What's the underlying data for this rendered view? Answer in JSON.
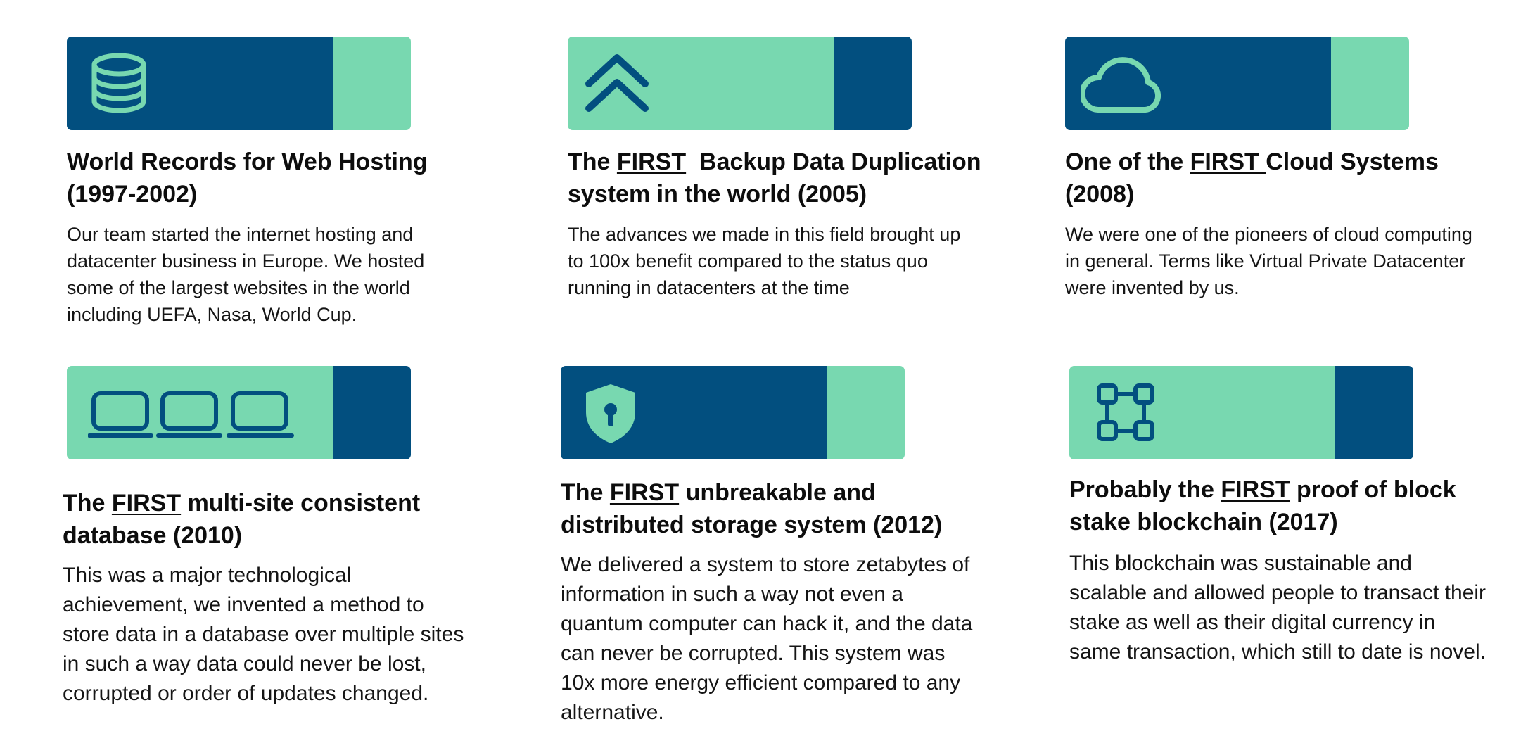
{
  "colors": {
    "dark": "#024f7f",
    "light": "#78d8b0"
  },
  "cards": [
    {
      "icon": "database-icon",
      "title_pre": "World Records for Web Hosting (1997-2002)",
      "title_highlight": "",
      "title_post": "",
      "description": "Our team started the internet hosting and datacenter business in Europe. We hosted some of the largest websites in the world including UEFA, Nasa, World Cup."
    },
    {
      "icon": "double-chevron-up-icon",
      "title_pre": "The ",
      "title_highlight": "FIRST",
      "title_post": "  Backup Data Duplication system in the world (2005)",
      "description": "The advances we made in this field brought up to 100x benefit compared to the status quo running in datacenters at the time"
    },
    {
      "icon": "cloud-icon",
      "title_pre": "One of the ",
      "title_highlight": "FIRST ",
      "title_post": "Cloud Systems (2008)",
      "description": "We were one of the pioneers of cloud computing in general. Terms like Virtual Private Datacenter were invented by us."
    },
    {
      "icon": "laptops-icon",
      "title_pre": "The ",
      "title_highlight": "FIRST",
      "title_post": " multi-site consistent database (2010)",
      "description": "This was a major technological achievement, we invented a method to store data in a database over multiple sites in such a way data could never be lost, corrupted or order of updates changed."
    },
    {
      "icon": "shield-lock-icon",
      "title_pre": "The ",
      "title_highlight": "FIRST",
      "title_post": " unbreakable and distributed storage system (2012)",
      "description": "We delivered a system to store zetabytes of information in such a way not even a quantum computer can hack it, and the data can never be corrupted.  This system was 10x more energy efficient compared to any alternative."
    },
    {
      "icon": "network-nodes-icon",
      "title_pre": "Probably the ",
      "title_highlight": "FIRST",
      "title_post": " proof of block stake blockchain (2017)",
      "description": "This blockchain was sustainable and scalable and allowed people to transact their stake as well as their digital currency in same transaction, which still to date is novel."
    }
  ]
}
